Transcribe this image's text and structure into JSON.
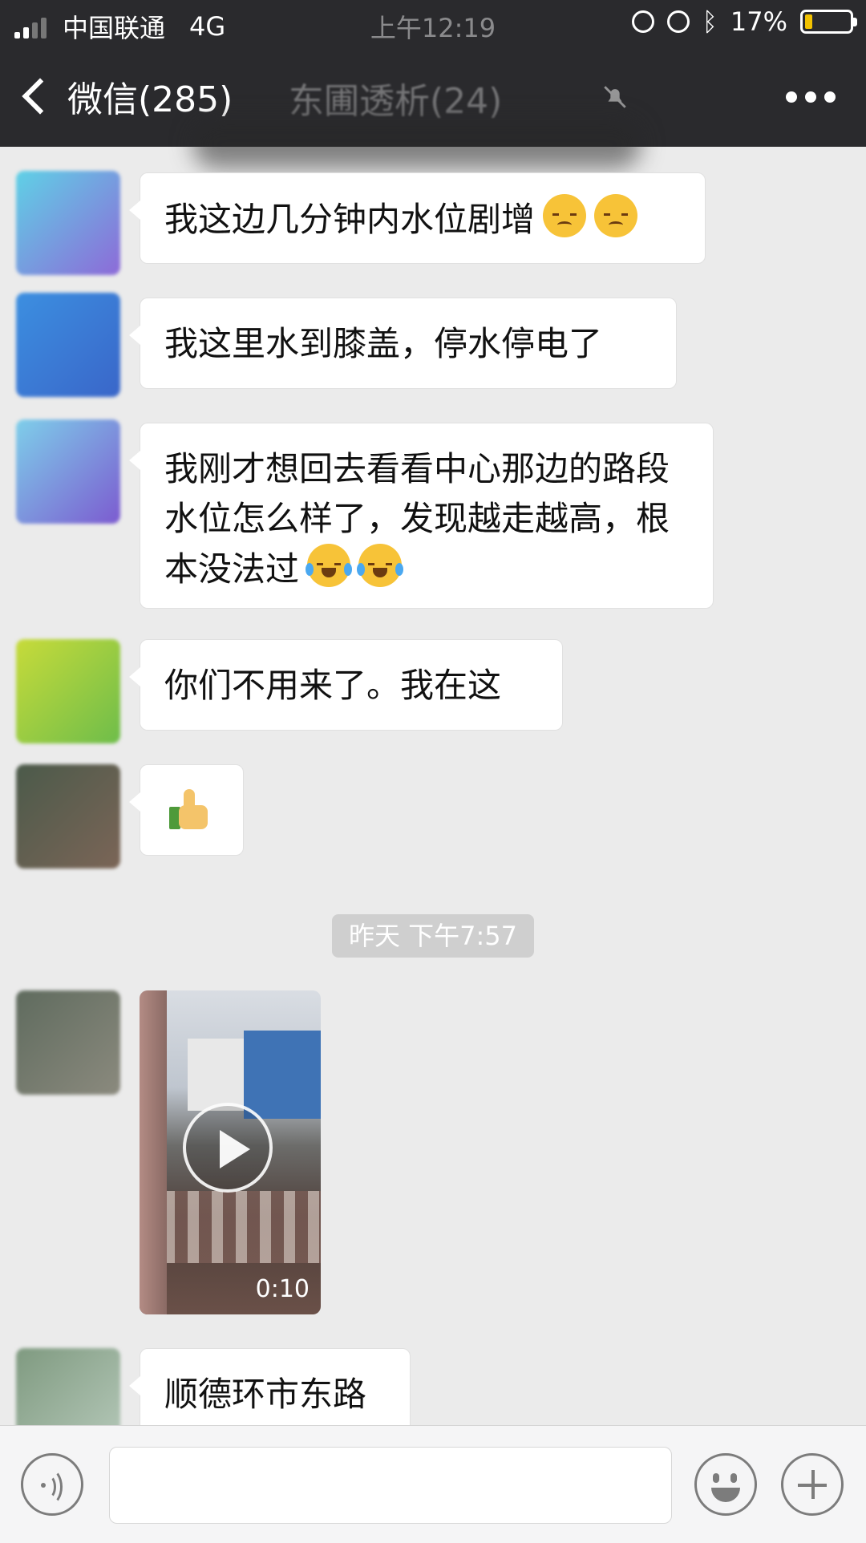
{
  "status_bar": {
    "carrier": "中国联通",
    "network": "4G",
    "time": "上午12:19",
    "battery_percent": "17%",
    "battery_level": 0.17,
    "icons": [
      "signal-icon",
      "rotation-lock-icon",
      "alarm-icon",
      "bluetooth-icon",
      "battery-icon"
    ]
  },
  "nav": {
    "back_label": "微信(285)",
    "chat_title": "东圃透析(24)",
    "more_icon": "more-icon",
    "mute_icon": "mute-icon"
  },
  "messages": [
    {
      "text": "我这边几分钟内水位剧增",
      "emojis": [
        "pensive",
        "pensive"
      ]
    },
    {
      "text": "我这里水到膝盖，停水停电了"
    },
    {
      "text": "我刚才想回去看看中心那边的路段水位怎么样了，发现越走越高，根本没法过",
      "emojis": [
        "laugh",
        "laugh"
      ]
    },
    {
      "text": "你们不用来了。我在这"
    },
    {
      "sticker": "thumbs-up"
    },
    {
      "video_duration": "0:10"
    },
    {
      "text": "顺德环市东路"
    }
  ],
  "timestamp": "昨天 下午7:57",
  "colors": {
    "header_bg": "#2a2a2d",
    "chat_bg": "#ebebeb",
    "bubble_bg": "#ffffff",
    "battery_fill": "#f2c200"
  },
  "input_bar": {
    "voice_icon": "voice-icon",
    "emoji_icon": "emoji-icon",
    "plus_icon": "plus-icon"
  }
}
